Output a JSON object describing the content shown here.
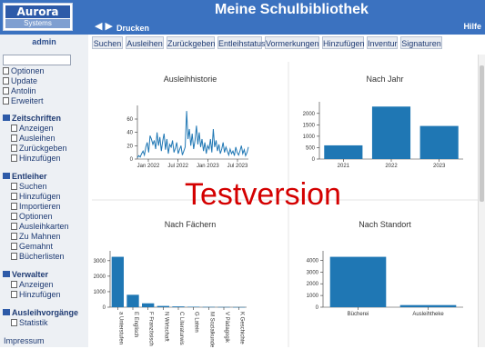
{
  "header": {
    "logo_main": "Aurora",
    "logo_sub": "Systems",
    "title": "Meine Schulbibliothek",
    "nav_arrows": "◀ ▶",
    "print": "Drucken",
    "help": "Hilfe"
  },
  "tabs": [
    {
      "label": "Suchen"
    },
    {
      "label": "Ausleihen"
    },
    {
      "label": "Zurückgeben"
    },
    {
      "label": "Entleihstatus"
    },
    {
      "label": "Vormerkungen"
    },
    {
      "label": "Hinzufügen"
    },
    {
      "label": "Inventur"
    },
    {
      "label": "Signaturen"
    }
  ],
  "sidebar": {
    "user": "admin",
    "top_items": [
      "Optionen",
      "Update",
      "Antolin",
      "Erweitert"
    ],
    "sections": [
      {
        "title": "Zeitschriften",
        "items": [
          "Anzeigen",
          "Ausleihen",
          "Zurückgeben",
          "Hinzufügen"
        ]
      },
      {
        "title": "Entleiher",
        "items": [
          "Suchen",
          "Hinzufügen",
          "Importieren",
          "Optionen",
          "Ausleihkarten",
          "Zu Mahnen",
          "Gemahnt",
          "Bücherlisten"
        ]
      },
      {
        "title": "Verwalter",
        "items": [
          "Anzeigen",
          "Hinzufügen"
        ]
      },
      {
        "title": "Ausleihvorgänge",
        "items": [
          "Statistik"
        ]
      }
    ],
    "footer": "Impressum"
  },
  "watermark": "Testversion",
  "chart_data": [
    {
      "type": "line",
      "title": "Ausleihhistorie",
      "x_ticks": [
        "Jan 2022",
        "Jul 2022",
        "Jan 2023",
        "Jul 2023"
      ],
      "y_ticks": [
        0,
        20,
        40,
        60
      ],
      "ylim": [
        0,
        75
      ],
      "values": [
        2,
        5,
        3,
        8,
        12,
        6,
        18,
        25,
        10,
        35,
        30,
        22,
        28,
        15,
        40,
        20,
        33,
        12,
        27,
        38,
        14,
        30,
        8,
        22,
        18,
        28,
        10,
        16,
        25,
        8,
        14,
        20,
        6,
        12,
        18,
        72,
        30,
        45,
        20,
        38,
        15,
        28,
        50,
        22,
        40,
        18,
        30,
        12,
        25,
        8,
        20,
        15,
        30,
        10,
        45,
        18,
        28,
        12,
        22,
        8,
        15,
        25,
        10,
        18,
        12,
        6,
        15,
        8,
        12,
        5,
        18,
        10,
        6,
        12,
        20,
        8,
        14,
        5,
        10,
        18
      ]
    },
    {
      "type": "bar",
      "title": "Nach Jahr",
      "categories": [
        "2021",
        "2022",
        "2023"
      ],
      "values": [
        600,
        2300,
        1450
      ],
      "y_ticks": [
        0,
        500,
        1000,
        1500,
        2000
      ],
      "ylim": [
        0,
        2350
      ]
    },
    {
      "type": "bar",
      "title": "Nach Fächern",
      "categories": [
        "a Unterstufen",
        "E Englisch",
        "F Französisch",
        "N Wirtschaft",
        "C Literaturwis",
        "G Latein",
        "M Sozialkunde",
        "V Pädagogik",
        "K Geschichte"
      ],
      "values": [
        3250,
        800,
        250,
        80,
        50,
        30,
        20,
        15,
        10
      ],
      "y_ticks": [
        0,
        1000,
        2000,
        3000
      ],
      "ylim": [
        0,
        3400
      ]
    },
    {
      "type": "bar",
      "title": "Nach Standort",
      "categories": [
        "Bücherei",
        "Ausleihtheke"
      ],
      "values": [
        4300,
        180
      ],
      "y_ticks": [
        0,
        1000,
        2000,
        3000,
        4000
      ],
      "ylim": [
        0,
        4500
      ]
    }
  ],
  "colors": {
    "header": "#3b72c0",
    "bar": "#1f77b4",
    "sidebar_bg": "#edf0f4",
    "watermark": "#d40000"
  }
}
